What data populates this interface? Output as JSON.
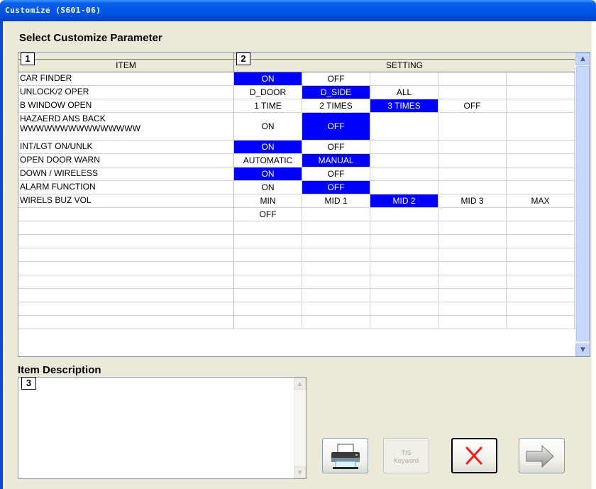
{
  "window": {
    "title": "Customize (S601-06)"
  },
  "labels": {
    "select_parameter": "Select Customize Parameter",
    "item_description": "Item Description"
  },
  "table": {
    "header_item_number": "1",
    "header_item": "ITEM",
    "header_setting_number": "2",
    "header_setting": "SETTING",
    "rows": [
      {
        "item": "CAR FINDER",
        "settings": [
          "ON",
          "OFF",
          "",
          "",
          ""
        ],
        "selected": 0
      },
      {
        "item": "UNLOCK/2 OPER",
        "settings": [
          "D_DOOR",
          "D_SIDE",
          "ALL",
          "",
          ""
        ],
        "selected": 1
      },
      {
        "item": "B WINDOW OPEN",
        "settings": [
          "1 TIME",
          "2 TIMES",
          "3 TIMES",
          "OFF",
          ""
        ],
        "selected": 2
      },
      {
        "item": "HAZAERD ANS BACK\nWWWWWWWWWWWWWWW",
        "settings": [
          "ON",
          "OFF",
          "",
          "",
          ""
        ],
        "selected": 1,
        "tall": true
      },
      {
        "item": "INT/LGT ON/UNLK",
        "settings": [
          "ON",
          "OFF",
          "",
          "",
          ""
        ],
        "selected": 0
      },
      {
        "item": "OPEN DOOR WARN",
        "settings": [
          "AUTOMATIC",
          "MANUAL",
          "",
          "",
          ""
        ],
        "selected": 1
      },
      {
        "item": "DOWN / WIRELESS",
        "settings": [
          "ON",
          "OFF",
          "",
          "",
          ""
        ],
        "selected": 0
      },
      {
        "item": "ALARM FUNCTION",
        "settings": [
          "ON",
          "OFF",
          "",
          "",
          ""
        ],
        "selected": 1
      },
      {
        "item": "WIRELS BUZ VOL",
        "settings": [
          "MIN",
          "MID 1",
          "MID 2",
          "MID 3",
          "MAX"
        ],
        "selected": 2
      },
      {
        "item": "",
        "settings": [
          "OFF",
          "",
          "",
          "",
          ""
        ],
        "selected": -1
      },
      {
        "item": "",
        "settings": [
          "",
          "",
          "",
          "",
          ""
        ],
        "selected": -1
      },
      {
        "item": "",
        "settings": [
          "",
          "",
          "",
          "",
          ""
        ],
        "selected": -1
      },
      {
        "item": "",
        "settings": [
          "",
          "",
          "",
          "",
          ""
        ],
        "selected": -1
      },
      {
        "item": "",
        "settings": [
          "",
          "",
          "",
          "",
          ""
        ],
        "selected": -1
      },
      {
        "item": "",
        "settings": [
          "",
          "",
          "",
          "",
          ""
        ],
        "selected": -1
      },
      {
        "item": "",
        "settings": [
          "",
          "",
          "",
          "",
          ""
        ],
        "selected": -1
      },
      {
        "item": "",
        "settings": [
          "",
          "",
          "",
          "",
          ""
        ],
        "selected": -1
      },
      {
        "item": "",
        "settings": [
          "",
          "",
          "",
          "",
          ""
        ],
        "selected": -1
      }
    ]
  },
  "description": {
    "number": "3",
    "text": ""
  },
  "buttons": {
    "print_icon": "printer-icon",
    "tis_keyword": "TIS\nKeyword",
    "cancel_icon": "red-x-icon",
    "next_icon": "right-arrow-icon"
  },
  "colors": {
    "title_bar": "#0055e5",
    "selection": "#0000ff",
    "dialog_bg": "#ece9d8",
    "cancel_x": "#ff0000"
  }
}
